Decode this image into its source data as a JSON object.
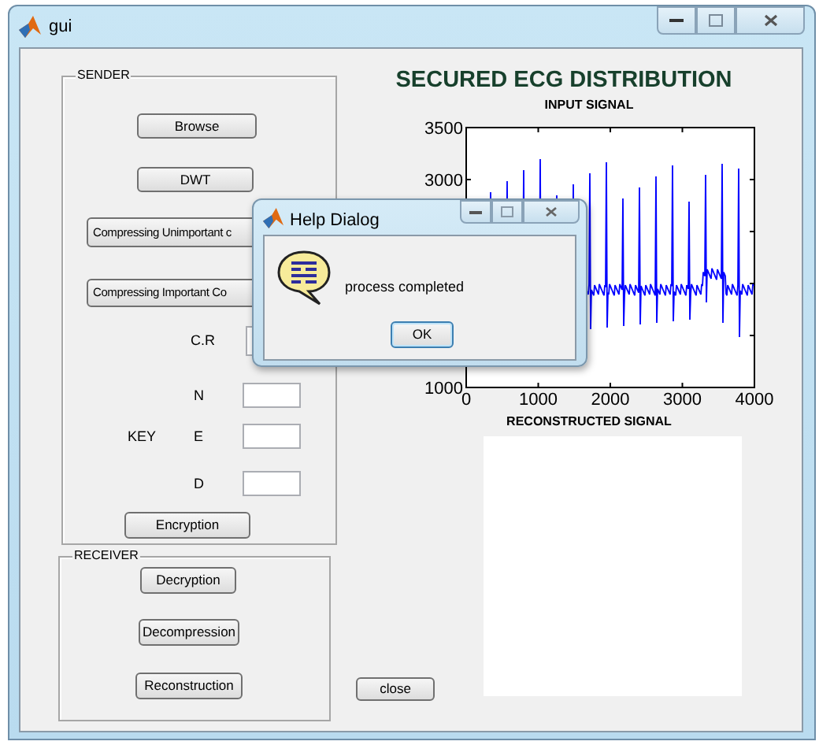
{
  "window": {
    "title": "gui"
  },
  "sender": {
    "label": "SENDER",
    "buttons": [
      "Browse",
      "DWT",
      "Compressing Unimportant c",
      "Compressing Important Co"
    ],
    "cr_label": "C.R",
    "key_label": "KEY",
    "key_fields": [
      {
        "label": "N"
      },
      {
        "label": "E"
      },
      {
        "label": "D"
      }
    ],
    "encrypt_button": "Encryption"
  },
  "receiver": {
    "label": "RECEIVER",
    "buttons": [
      "Decryption",
      "Decompression",
      "Reconstruction"
    ]
  },
  "heading": "SECURED ECG DISTRIBUTION",
  "input_axes": {
    "title": "INPUT SIGNAL",
    "yticks": [
      "3500",
      "3000",
      "1000"
    ],
    "xticks": [
      "0",
      "1000",
      "2000",
      "3000",
      "4000"
    ]
  },
  "output_axes": {
    "title": "RECONSTRUCTED SIGNAL"
  },
  "close_button": "close",
  "dialog": {
    "title": "Help Dialog",
    "message": "process completed",
    "button": "OK"
  }
}
